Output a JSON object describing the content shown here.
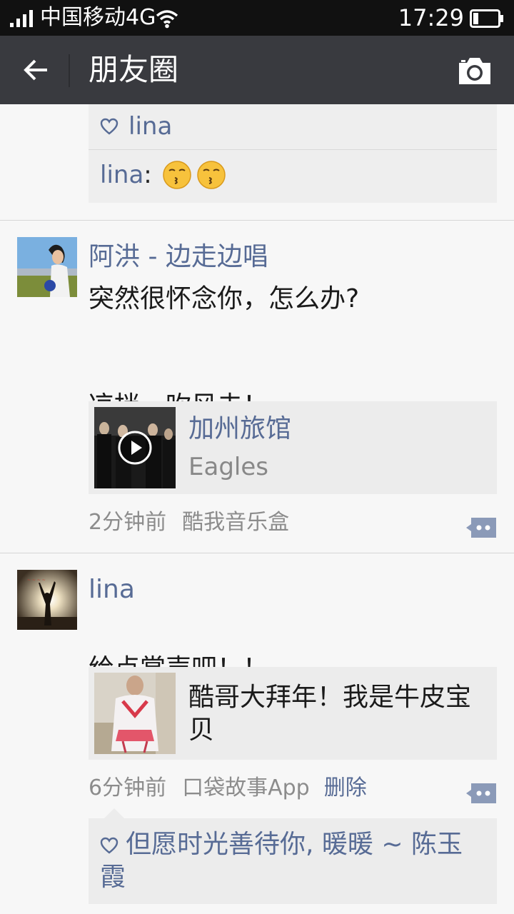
{
  "status_bar": {
    "carrier": "中国移动4G",
    "time": "17:29"
  },
  "header": {
    "title": "朋友圈"
  },
  "previous_post": {
    "likes": "lina",
    "comment_author": "lina",
    "comment_separator": ":"
  },
  "posts": [
    {
      "nickname": "阿洪 - 边走边唱",
      "text_line1": "突然很怀念你，怎么办?",
      "text_line2": "凉拌，吹风去！",
      "card": {
        "title": "加州旅馆",
        "subtitle": "Eagles"
      },
      "time": "2分钟前",
      "source": "酷我音乐盒"
    },
    {
      "nickname": "lina",
      "text": "给点掌声吧！！",
      "card": {
        "title": "酷哥大拜年！我是牛皮宝贝"
      },
      "time": "6分钟前",
      "source": "口袋故事App",
      "delete_label": "删除",
      "liked_by": "但愿时光善待你, 暖暖 ~ 陈玉霞"
    }
  ],
  "colors": {
    "status_bar": "#111111",
    "title_bar": "#393a3f",
    "link": "#576b95",
    "background": "#f7f7f7"
  },
  "icons": [
    "signal-icon",
    "wifi-icon",
    "battery-icon",
    "back-arrow-icon",
    "camera-icon",
    "heart-icon",
    "play-icon",
    "comment-icon",
    "kiss-emoji",
    "smirk-emoji",
    "grin-emoji"
  ]
}
